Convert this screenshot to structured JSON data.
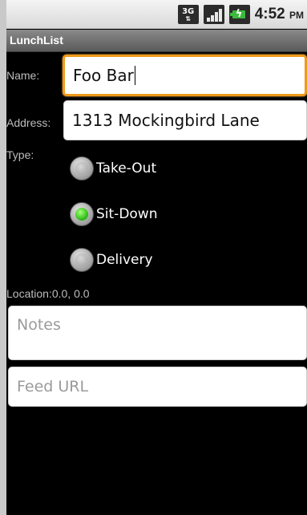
{
  "status_bar": {
    "network": "3G",
    "time": "4:52",
    "ampm": "PM"
  },
  "app": {
    "title": "LunchList"
  },
  "form": {
    "name_label": "Name:",
    "name_value": "Foo Bar",
    "address_label": "Address:",
    "address_value": "1313 Mockingbird Lane",
    "type_label": "Type:",
    "types": [
      {
        "label": "Take-Out",
        "selected": false
      },
      {
        "label": "Sit-Down",
        "selected": true
      },
      {
        "label": "Delivery",
        "selected": false
      }
    ],
    "location_label": "Location:",
    "location_value": "0.0, 0.0",
    "notes_placeholder": "Notes",
    "feed_placeholder": "Feed URL"
  },
  "colors": {
    "focus_border": "#f09a1a",
    "radio_selected": "#34c21c"
  }
}
